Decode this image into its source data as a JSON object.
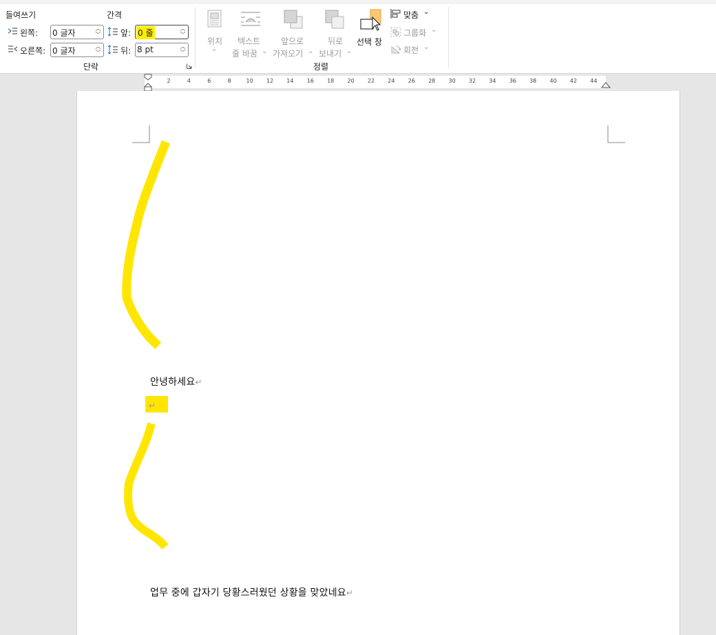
{
  "ribbon": {
    "indent": {
      "title": "들여쓰기",
      "left_label": "왼쪽:",
      "left_value": "0 글자",
      "right_label": "오른쪽:",
      "right_value": "0 글자"
    },
    "spacing": {
      "title": "간격",
      "before_label": "앞:",
      "before_value": "0 줄",
      "after_label": "뒤:",
      "after_value": "8 pt"
    },
    "paragraph_group_label": "단락",
    "arrange": {
      "position_label": "위치",
      "wrap_text_label_1": "텍스트",
      "wrap_text_label_2": "줄 바꿈",
      "bring_forward_label_1": "앞으로",
      "bring_forward_label_2": "가져오기",
      "send_backward_label_1": "뒤로",
      "send_backward_label_2": "보내기",
      "selection_pane_label": "선택 창",
      "align_label": "맞춤",
      "group_label": "그룹화",
      "rotate_label": "회전",
      "group_name": "정렬"
    },
    "chevron": "⌄"
  },
  "ruler": {
    "ticks": [
      "2",
      "4",
      "6",
      "8",
      "10",
      "12",
      "14",
      "16",
      "18",
      "20",
      "22",
      "24",
      "26",
      "28",
      "30",
      "32",
      "34",
      "36",
      "38",
      "40",
      "42",
      "44"
    ]
  },
  "document": {
    "paragraph_1": "안녕하세요",
    "paragraph_3": "업무 중에 갑자기 당황스러웠던 상황을 맞았네요",
    "paragraph_mark": "↵"
  },
  "colors": {
    "highlight": "#ffe600",
    "ribbon_bg": "#ffffff",
    "workspace_bg": "#e6e6e6"
  }
}
